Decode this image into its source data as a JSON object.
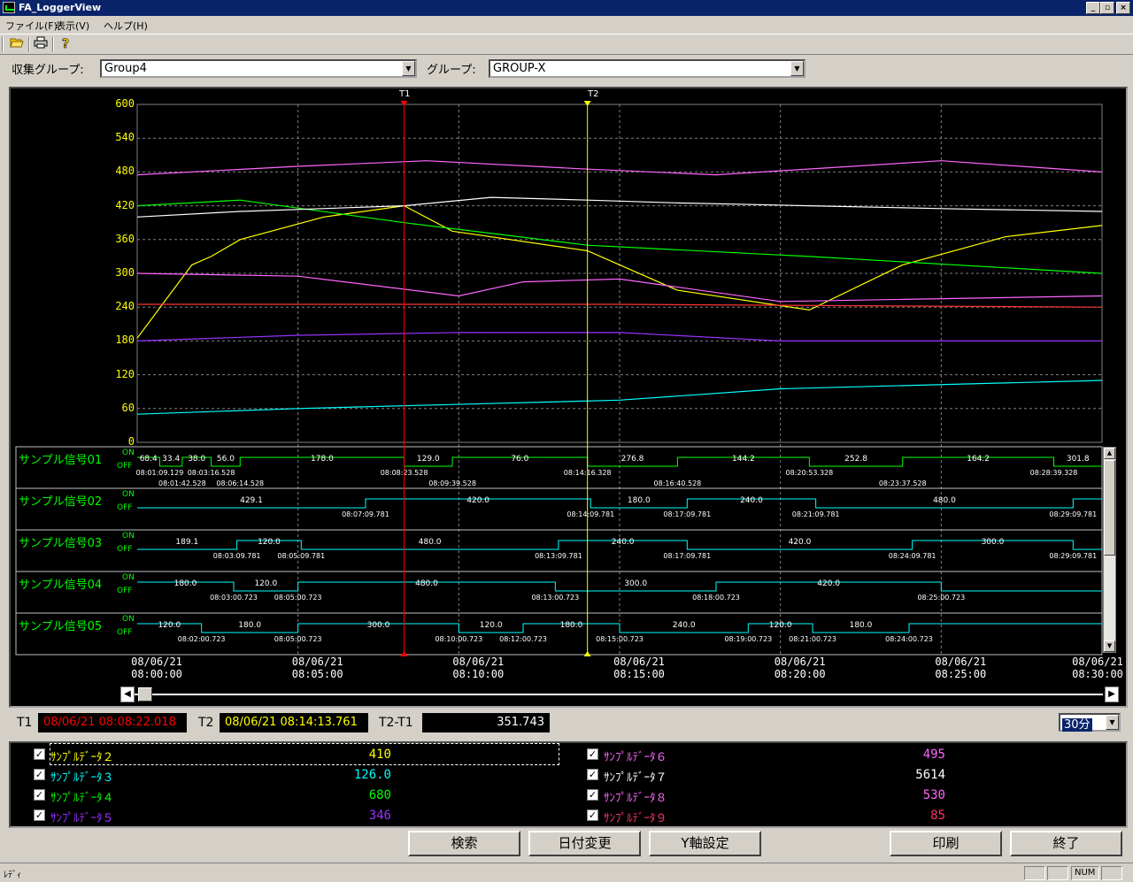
{
  "window": {
    "title": "FA_LoggerView",
    "controls": [
      "_",
      "▫",
      "×"
    ]
  },
  "menu": [
    {
      "label": "ファイル(F)"
    },
    {
      "label": "表示(V)"
    },
    {
      "label": "ヘルプ(H)"
    }
  ],
  "toolbar": [
    {
      "icon": "open-folder-icon"
    },
    {
      "icon": "print-icon"
    },
    {
      "icon": "help-icon"
    }
  ],
  "filters": {
    "collect_group_label": "収集グループ:",
    "collect_group_value": "Group4",
    "group_label": "グループ:",
    "group_value": "GROUP-X"
  },
  "colors": {
    "s1": "#ffff00",
    "s2": "#00ffff",
    "s3": "#00ff00",
    "s4": "#9933ff",
    "s5": "#ff66ff",
    "s6": "#ffffff",
    "s7": "#ff66ff",
    "s8": "#ff3333",
    "t1": "#ff0000",
    "t2": "#ffff00"
  },
  "chart_data": {
    "type": "line",
    "x_range": [
      "08/06/21 08:00:00",
      "08/06/21 08:30:00"
    ],
    "ylim": [
      0,
      600
    ],
    "y_ticks": [
      0,
      60,
      120,
      180,
      240,
      300,
      360,
      420,
      480,
      540,
      600
    ],
    "x_ticks": [
      {
        "d": "08/06/21",
        "t": "08:00:00"
      },
      {
        "d": "08/06/21",
        "t": "08:05:00"
      },
      {
        "d": "08/06/21",
        "t": "08:10:00"
      },
      {
        "d": "08/06/21",
        "t": "08:15:00"
      },
      {
        "d": "08/06/21",
        "t": "08:20:00"
      },
      {
        "d": "08/06/21",
        "t": "08:25:00"
      },
      {
        "d": "08/06/21",
        "t": "08:30:00"
      }
    ],
    "series": [
      {
        "color": "#ffff00",
        "x": [
          0,
          1.7,
          2.3,
          3.2,
          5.8,
          8.3,
          9.8,
          14.0,
          16.8,
          20.9,
          23.8,
          27.0,
          30.0
        ],
        "values": [
          185,
          315,
          330,
          360,
          400,
          420,
          375,
          340,
          270,
          235,
          315,
          365,
          385
        ]
      },
      {
        "color": "#00ff00",
        "x": [
          0,
          3.2,
          8.3,
          14.0,
          20.9,
          30.0
        ],
        "values": [
          420,
          430,
          390,
          350,
          330,
          300
        ]
      },
      {
        "color": "#ffffff",
        "x": [
          0,
          3.2,
          8.3,
          11.0,
          14.0,
          16.8,
          20.9,
          25.0,
          30.0
        ],
        "values": [
          400,
          410,
          420,
          435,
          430,
          425,
          420,
          415,
          410
        ]
      },
      {
        "color": "#ff66ff",
        "x": [
          0,
          5.0,
          9.0,
          14.0,
          18.0,
          25.0,
          30.0
        ],
        "values": [
          475,
          490,
          500,
          485,
          475,
          500,
          480
        ]
      },
      {
        "color": "#ff66ff",
        "x": [
          0,
          5.0,
          10.0,
          12.0,
          15.0,
          20.0,
          30.0
        ],
        "values": [
          300,
          295,
          260,
          285,
          290,
          250,
          260
        ]
      },
      {
        "color": "#ff3333",
        "x": [
          0,
          15.0,
          30.0
        ],
        "values": [
          245,
          245,
          240
        ]
      },
      {
        "color": "#9933ff",
        "x": [
          0,
          5.0,
          10.0,
          15.0,
          20.0,
          30.0
        ],
        "values": [
          180,
          190,
          195,
          195,
          180,
          180
        ]
      },
      {
        "color": "#00ffff",
        "x": [
          0,
          5.0,
          15.0,
          20.0,
          30.0
        ],
        "values": [
          50,
          60,
          75,
          95,
          110
        ]
      }
    ]
  },
  "cursors": {
    "t1": {
      "label": "T1",
      "x": 8.3
    },
    "t2": {
      "label": "T2",
      "x": 14.0
    }
  },
  "signals": [
    {
      "name": "サンプル信号01",
      "on": "ON",
      "off": "OFF",
      "transitions": [
        0,
        0.7,
        1.4,
        2.3,
        3.2,
        8.3,
        9.8,
        14.0,
        16.8,
        20.9,
        23.8,
        28.5
      ],
      "start_high": true,
      "values": [
        "68.4",
        "33.4",
        "38.0",
        "56.0",
        "178.0",
        "129.0",
        "76.0",
        "276.8",
        "144.2",
        "252.8",
        "164.2",
        "301.8"
      ],
      "times": [
        "08:01:09.129",
        "08:01:42.528",
        "08:03:16.528",
        "08:06:14.528",
        "08:08:23.528",
        "08:09:39.528",
        "08:14:16.328",
        "08:16:40.528",
        "08:20:53.328",
        "08:23:37.528",
        "08:28:39.328"
      ]
    },
    {
      "name": "サンプル信号02",
      "on": "ON",
      "off": "OFF",
      "transitions": [
        0,
        7.1,
        14.1,
        17.1,
        21.1,
        29.1
      ],
      "start_high": false,
      "values": [
        "429.1",
        "420.0",
        "180.0",
        "240.0",
        "480.0"
      ],
      "times": [
        "08:07:09.781",
        "08:14:09.781",
        "08:17:09.781",
        "08:21:09.781",
        "08:29:09.781"
      ]
    },
    {
      "name": "サンプル信号03",
      "on": "ON",
      "off": "OFF",
      "transitions": [
        0,
        3.1,
        5.1,
        13.1,
        17.1,
        24.1,
        29.1
      ],
      "start_high": false,
      "values": [
        "189.1",
        "120.0",
        "480.0",
        "240.0",
        "420.0",
        "300.0"
      ],
      "times": [
        "08:03:09.781",
        "08:05:09.781",
        "08:13:09.781",
        "08:17:09.781",
        "08:24:09.781",
        "08:29:09.781"
      ]
    },
    {
      "name": "サンプル信号04",
      "on": "ON",
      "off": "OFF",
      "transitions": [
        0,
        3.0,
        5.0,
        13.0,
        18.0,
        25.0
      ],
      "start_high": true,
      "values": [
        "180.0",
        "120.0",
        "480.0",
        "300.0",
        "420.0"
      ],
      "times": [
        "08:03:00.723",
        "08:05:00.723",
        "08:13:00.723",
        "08:18:00.723",
        "08:25:00.723"
      ]
    },
    {
      "name": "サンプル信号05",
      "on": "ON",
      "off": "OFF",
      "transitions": [
        0,
        2.0,
        5.0,
        10.0,
        12.0,
        15.0,
        19.0,
        21.0,
        24.0
      ],
      "start_high": true,
      "values": [
        "120.0",
        "180.0",
        "300.0",
        "120.0",
        "180.0",
        "240.0",
        "120.0",
        "180.0"
      ],
      "times": [
        "08:02:00.723",
        "08:05:00.723",
        "08:10:00.723",
        "08:12:00.723",
        "08:15:00.723",
        "08:19:00.723",
        "08:21:00.723",
        "08:24:00.723"
      ]
    }
  ],
  "time_readout": {
    "t1_label": "T1",
    "t1_value": "08/06/21 08:08:22.018",
    "t2_label": "T2",
    "t2_value": "08/06/21 08:14:13.761",
    "diff_label": "T2-T1",
    "diff_value": "351.743",
    "span_value": "30分"
  },
  "legend": {
    "left": [
      {
        "name": "ｻﾝﾌﾟﾙﾃﾞｰﾀ２",
        "value": "410",
        "color": "#ffff00"
      },
      {
        "name": "ｻﾝﾌﾟﾙﾃﾞｰﾀ３",
        "value": "126.0",
        "color": "#00ffff"
      },
      {
        "name": "ｻﾝﾌﾟﾙﾃﾞｰﾀ４",
        "value": "680",
        "color": "#00ff00"
      },
      {
        "name": "ｻﾝﾌﾟﾙﾃﾞｰﾀ５",
        "value": "346",
        "color": "#9933ff"
      }
    ],
    "right": [
      {
        "name": "ｻﾝﾌﾟﾙﾃﾞｰﾀ６",
        "value": "495",
        "color": "#ff66ff"
      },
      {
        "name": "ｻﾝﾌﾟﾙﾃﾞｰﾀ７",
        "value": "5614",
        "color": "#ffffff"
      },
      {
        "name": "ｻﾝﾌﾟﾙﾃﾞｰﾀ８",
        "value": "530",
        "color": "#ff66ff"
      },
      {
        "name": "ｻﾝﾌﾟﾙﾃﾞｰﾀ９",
        "value": "85",
        "color": "#ff3366"
      }
    ]
  },
  "buttons": {
    "search": "検索",
    "date_change": "日付変更",
    "y_axis": "Y軸設定",
    "print": "印刷",
    "exit": "終了"
  },
  "status": {
    "text": "ﾚﾃﾞｨ",
    "num": "NUM"
  }
}
